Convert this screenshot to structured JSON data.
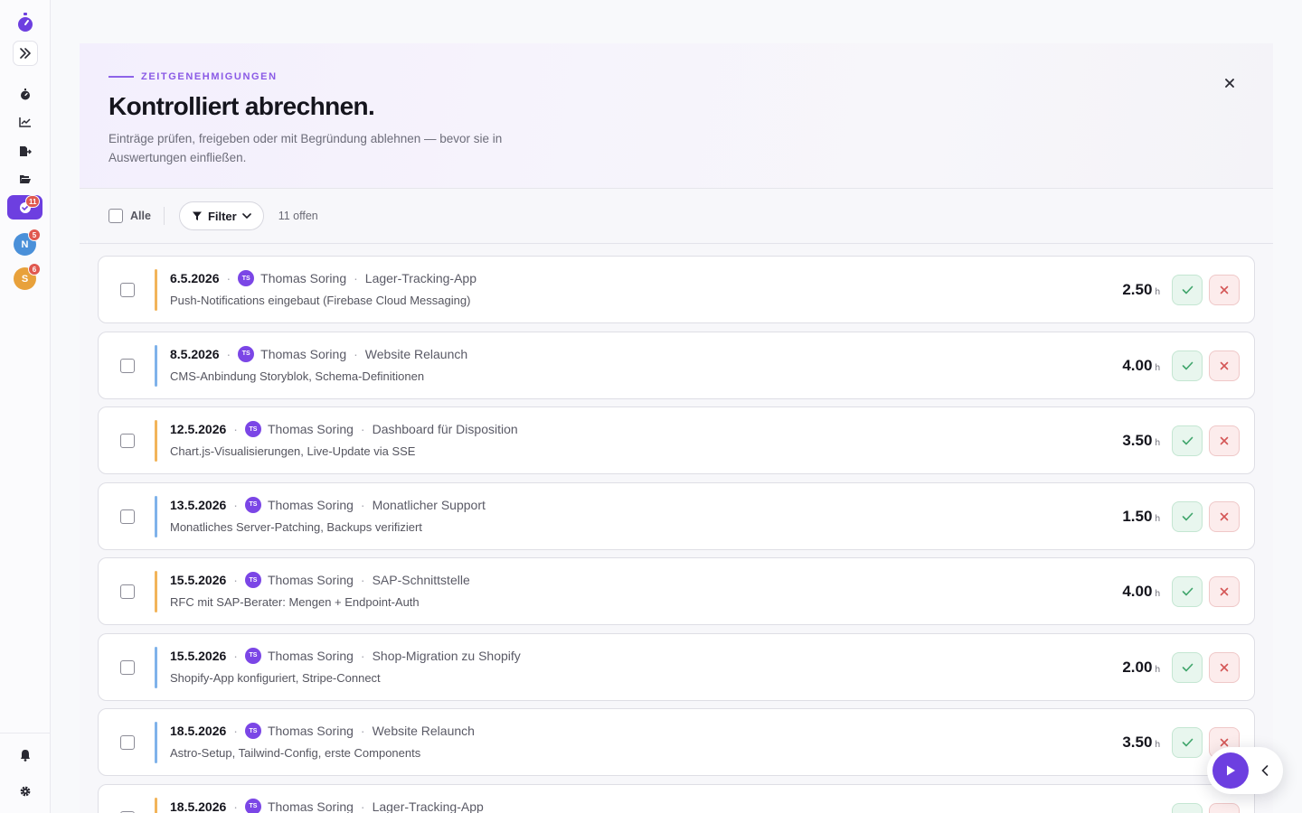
{
  "sidebar": {
    "approvals_badge": "11",
    "workspaces": [
      {
        "initial": "N",
        "badge": "5",
        "color": "#4a90d9"
      },
      {
        "initial": "S",
        "badge": "6",
        "color": "#e8a13b"
      }
    ],
    "accent": "#6d3fe0"
  },
  "hero": {
    "eyebrow": "ZEITGENEHMIGUNGEN",
    "title": "Kontrolliert abrechnen.",
    "subtitle": "Einträge prüfen, freigeben oder mit Begründung ablehnen — bevor sie in Auswertungen einfließen."
  },
  "toolbar": {
    "select_all_label": "Alle",
    "filter_label": "Filter",
    "count_text": "11 offen"
  },
  "entries": [
    {
      "date": "6.5.2026",
      "initials": "TS",
      "user": "Thomas Soring",
      "project": "Lager-Tracking-App",
      "description": "Push-Notifications eingebaut (Firebase Cloud Messaging)",
      "hours": "2.50",
      "unit": "h",
      "bar_color": "#f2b45a"
    },
    {
      "date": "8.5.2026",
      "initials": "TS",
      "user": "Thomas Soring",
      "project": "Website Relaunch",
      "description": "CMS-Anbindung Storyblok, Schema-Definitionen",
      "hours": "4.00",
      "unit": "h",
      "bar_color": "#7fb2ea"
    },
    {
      "date": "12.5.2026",
      "initials": "TS",
      "user": "Thomas Soring",
      "project": "Dashboard für Disposition",
      "description": "Chart.js-Visualisierungen, Live-Update via SSE",
      "hours": "3.50",
      "unit": "h",
      "bar_color": "#f2b45a"
    },
    {
      "date": "13.5.2026",
      "initials": "TS",
      "user": "Thomas Soring",
      "project": "Monatlicher Support",
      "description": "Monatliches Server-Patching, Backups verifiziert",
      "hours": "1.50",
      "unit": "h",
      "bar_color": "#7fb2ea"
    },
    {
      "date": "15.5.2026",
      "initials": "TS",
      "user": "Thomas Soring",
      "project": "SAP-Schnittstelle",
      "description": "RFC mit SAP-Berater: Mengen + Endpoint-Auth",
      "hours": "4.00",
      "unit": "h",
      "bar_color": "#f2b45a"
    },
    {
      "date": "15.5.2026",
      "initials": "TS",
      "user": "Thomas Soring",
      "project": "Shop-Migration zu Shopify",
      "description": "Shopify-App konfiguriert, Stripe-Connect",
      "hours": "2.00",
      "unit": "h",
      "bar_color": "#7fb2ea"
    },
    {
      "date": "18.5.2026",
      "initials": "TS",
      "user": "Thomas Soring",
      "project": "Website Relaunch",
      "description": "Astro-Setup, Tailwind-Config, erste Components",
      "hours": "3.50",
      "unit": "h",
      "bar_color": "#7fb2ea"
    },
    {
      "date": "18.5.2026",
      "initials": "TS",
      "user": "Thomas Soring",
      "project": "Lager-Tracking-App",
      "description": "",
      "hours": "",
      "unit": "",
      "bar_color": "#f2b45a"
    }
  ]
}
